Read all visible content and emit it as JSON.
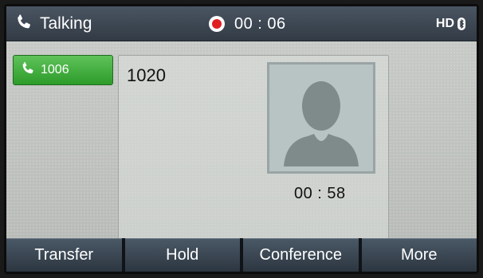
{
  "status_bar": {
    "state": "Talking",
    "recording_time": "00 : 06",
    "hd_label": "HD",
    "icons": [
      "handset-icon",
      "record-icon",
      "bluetooth-icon"
    ]
  },
  "line_key": {
    "number": "1006",
    "icon": "handset-icon",
    "color": "#3aae36"
  },
  "call_panel": {
    "remote_party": "1020",
    "avatar_icon": "person-silhouette-icon",
    "call_duration": "00 : 58"
  },
  "softkeys": {
    "transfer": "Transfer",
    "hold": "Hold",
    "conference": "Conference",
    "more": "More"
  }
}
